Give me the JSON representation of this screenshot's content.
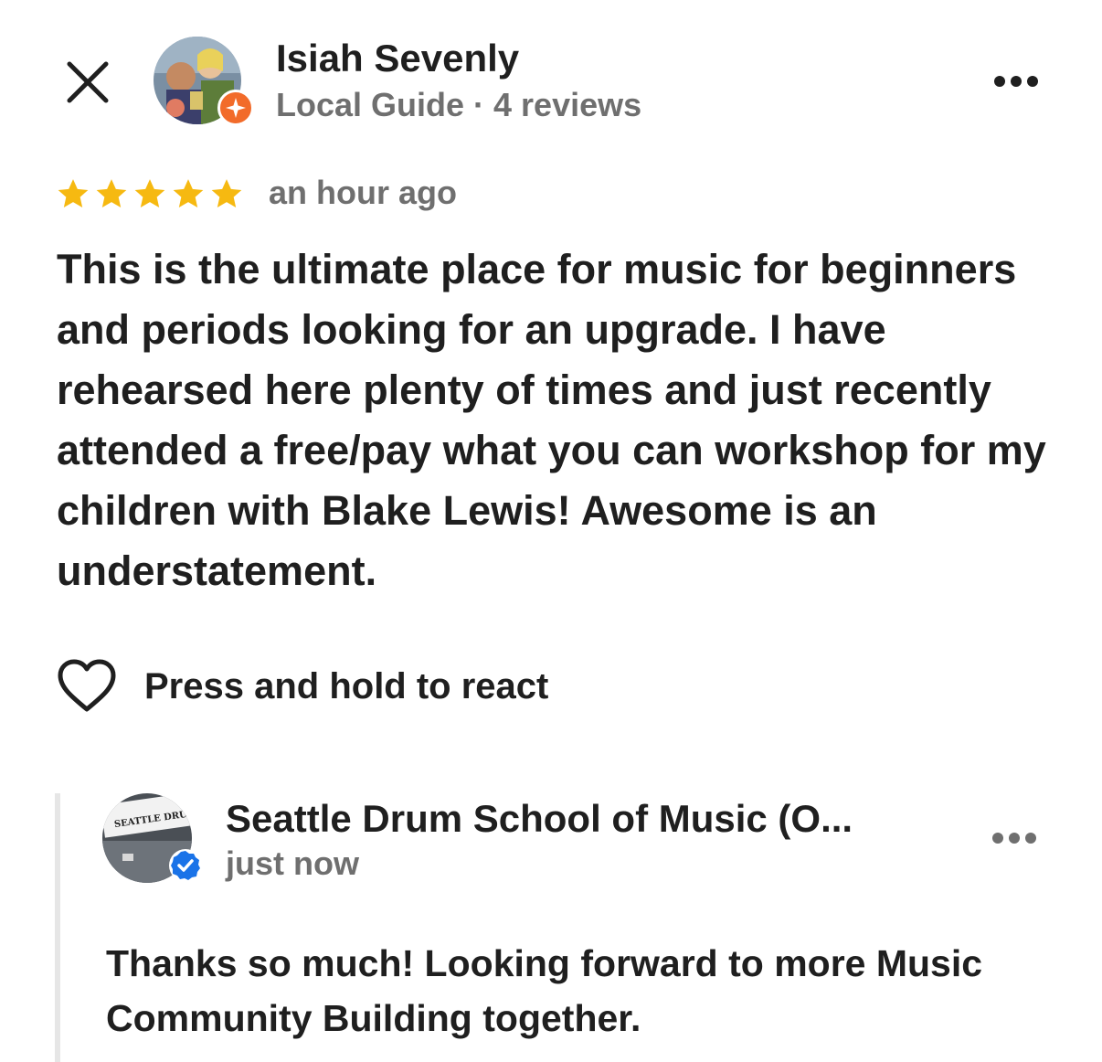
{
  "header": {
    "reviewer_name": "Isiah Sevenly",
    "reviewer_meta": "Local Guide · 4 reviews"
  },
  "icons": {
    "close": "close-icon",
    "more": "more-horizontal-icon",
    "star": "star-icon",
    "heart": "heart-outline-icon",
    "local_guide": "local-guide-badge-icon",
    "verified": "verified-check-icon"
  },
  "review": {
    "rating": 5,
    "rating_max": 5,
    "time": "an hour ago",
    "text": "This is the ultimate place for music for beginners and periods looking for an upgrade. I have rehearsed here plenty of times and just recently attended a free/pay what you can workshop for my children with Blake Lewis! Awesome is an understatement."
  },
  "react": {
    "label": "Press and hold to react"
  },
  "owner_reply": {
    "owner_name": "Seattle Drum School of Music (O...",
    "time": "just now",
    "text": "Thanks so much! Looking forward to more Music Community Building together.",
    "avatar_sign_text": "SEATTLE DRUM SCHOOL"
  },
  "colors": {
    "star": "#f6b911",
    "secondary_text": "#6f6f6f",
    "primary_text": "#1f1f1f",
    "local_guide_badge": "#f26b2a",
    "verified_badge": "#1a73e8",
    "reply_bar": "#e6e6e6"
  }
}
